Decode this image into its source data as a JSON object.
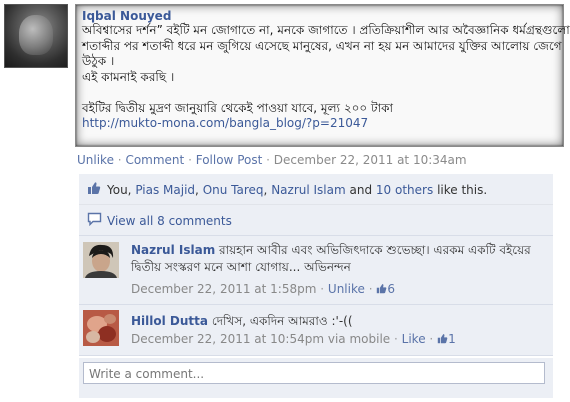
{
  "post": {
    "author": "Iqbal Nouyed",
    "lines": [
      "অবিশ্বাসের দর্শন” বইটি মন জোগাতে না, মনকে জাগাতে । প্রতিক্রিয়াশীল আর অবৈজ্ঞানিক ধর্মগ্রন্থগুলো",
      "শতাব্দীর পর শতাব্দী ধরে মন জুগিয়ে এসেছে মানুষের, এখন না হয় মন আমাদের যুক্তির আলোয় জেগে",
      "উঠুক ।",
      "এই কামনাই করছি ।",
      "",
      "বইটির দ্বিতীয় মুদ্রণ জানুয়ারি থেকেই পাওয়া যাবে, মূল্য ২০০ টাকা"
    ],
    "link": "http://mukto-mona.com/bangla_blog/?p=21047"
  },
  "actions": {
    "unlike": "Unlike",
    "comment": "Comment",
    "follow": "Follow Post",
    "timestamp": "December 22, 2011 at 10:34am",
    "separator": "·"
  },
  "likes": {
    "prefix": "You,",
    "names": [
      "Pias Majid",
      "Onu Tareq",
      "Nazrul Islam"
    ],
    "sep1": ",",
    "and": "and",
    "others": "10 others",
    "suffix": "like this."
  },
  "view_all": "View all 8 comments",
  "comments": [
    {
      "name": "Nazrul Islam",
      "text_line1": "রায়হান আবীর এবং অভিজিৎদাকে শুভেচ্ছা। এরকম একটি বইয়ের",
      "text_line2": "দ্বিতীয় সংস্করণ মনে আশা যোগায়... অভিনন্দন",
      "time": "December 22, 2011 at 1:58pm",
      "action": "Unlike",
      "like_count": "6"
    },
    {
      "name": "Hillol Dutta",
      "text_line1": "দেখিস, একদিন আমরাও :'-((",
      "time": "December 22, 2011 at 10:54pm via mobile",
      "action": "Like",
      "like_count": "1"
    }
  ],
  "write_comment_placeholder": "Write a comment...",
  "colors": {
    "link": "#3b5998",
    "panel": "#eceff5",
    "meta": "#888888"
  }
}
